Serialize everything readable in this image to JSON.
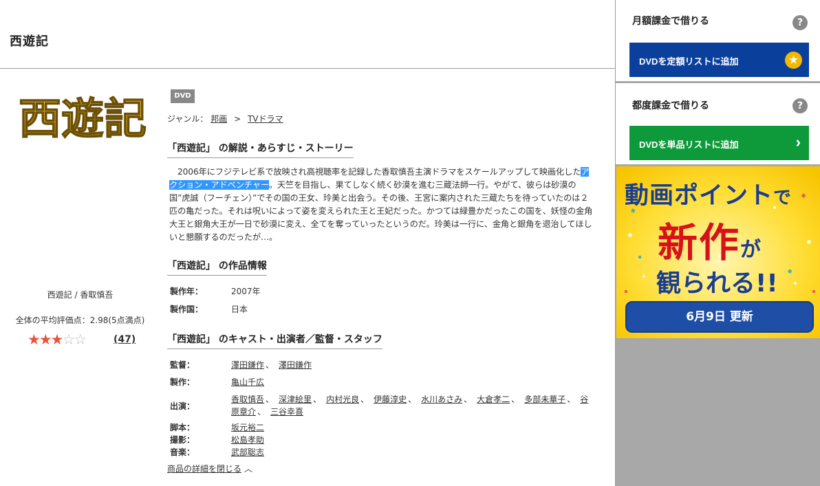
{
  "header": {
    "title": "西遊記"
  },
  "logo": {
    "text": "西遊記",
    "colors": [
      "#c9a227",
      "#8a6a12"
    ]
  },
  "meta": {
    "title_cast": "西遊記 / 香取慎吾",
    "rating_text": "全体の平均評価点：2.98(5点満点)",
    "rating_value": 2.98,
    "stars_filled": 3,
    "stars_total": 5,
    "review_count": "(47)"
  },
  "badge": "DVD",
  "genre": {
    "label": "ジャンル：",
    "items": [
      "邦画",
      "TVドラマ"
    ],
    "separator": ">"
  },
  "story": {
    "heading": "「西遊記」 の解説・あらすじ・ストーリー",
    "before": "2006年にフジテレビ系で放映され高視聴率を記録した香取慎吾主演ドラマをスケールアップして映画化した",
    "highlight": "アクション・アドベンチャー",
    "after": "。天竺を目指し、果てしなく続く砂漠を進む三蔵法師一行。やがて、彼らは砂漠の国”虎誠（フーチェン）”でその国の王女、玲美と出会う。その後、王宮に案内された三蔵たちを待っていたのは２匹の亀だった。それは呪いによって姿を変えられた王と王妃だった。かつては緑豊かだったこの国を、妖怪の金角大王と銀角大王が一日で砂漠に変え、全てを奪っていったというのだ。玲美は一行に、金角と銀角を退治してほしいと懇願するのだったが…。"
  },
  "info": {
    "heading": "「西遊記」 の作品情報",
    "rows": [
      {
        "label": "製作年：",
        "value": "2007年"
      },
      {
        "label": "製作国：",
        "value": "日本"
      }
    ]
  },
  "cast": {
    "heading": "「西遊記」 のキャスト・出演者／監督・スタッフ",
    "rows": [
      {
        "label": "監督：",
        "names": [
          "澤田鎌作",
          "澤田鎌作"
        ]
      },
      {
        "label": "製作：",
        "names": [
          "亀山千広"
        ]
      },
      {
        "label": "出演：",
        "names": [
          "香取慎吾",
          "深津絵里",
          "内村光良",
          "伊藤淳史",
          "水川あさみ",
          "大倉孝二",
          "多部未華子",
          "谷原章介",
          "三谷幸喜"
        ]
      },
      {
        "label": "脚本：",
        "names": [
          "坂元裕二"
        ]
      },
      {
        "label": "撮影：",
        "names": [
          "松島孝助"
        ]
      },
      {
        "label": "音楽：",
        "names": [
          "武部聡志"
        ]
      }
    ]
  },
  "close_link": "商品の詳細を閉じる",
  "sidebar": {
    "monthly": {
      "title": "月額課金で借りる",
      "button": "DVDを定額リストに追加",
      "button_color": "#0a3f9c"
    },
    "single": {
      "title": "都度課金で借りる",
      "button": "DVDを単品リストに追加",
      "button_color": "#0e9a3a"
    },
    "help_icon": "?",
    "banner": {
      "line1a": "動画ポイント",
      "line1b": "で",
      "line2a": "新作",
      "line2b": "が",
      "line3": "観られる!!",
      "date": "6月9日 更新"
    }
  }
}
